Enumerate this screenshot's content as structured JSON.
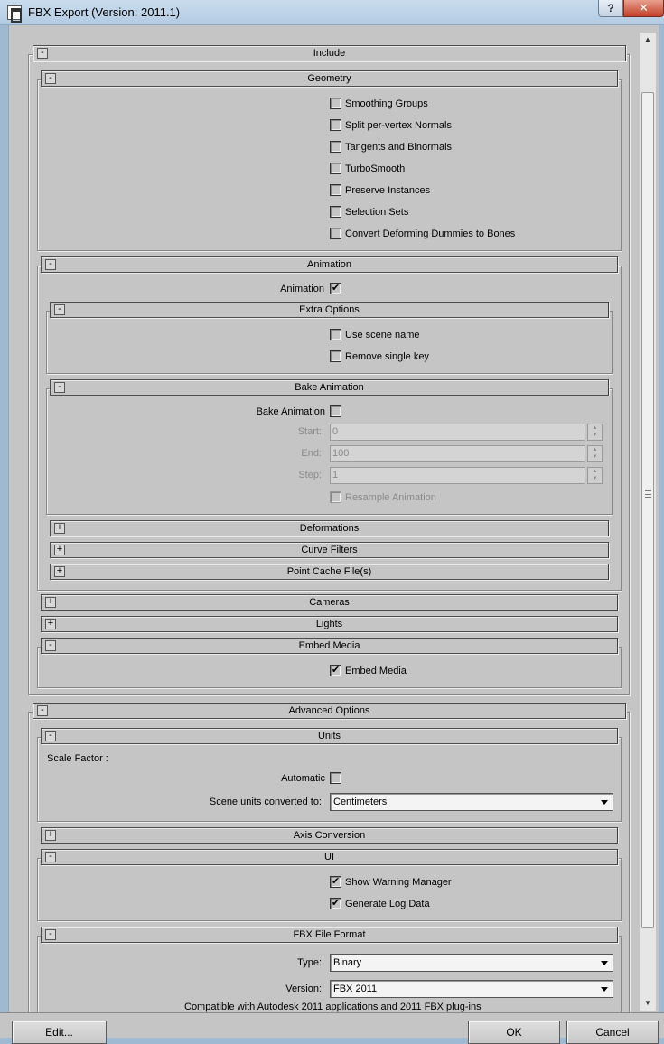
{
  "window": {
    "title": "FBX Export (Version: 2011.1)",
    "help_label": "?",
    "close_label": "✕"
  },
  "icons": {
    "expanded": "-",
    "collapsed": "+",
    "scroll_up": "▲",
    "scroll_down": "▼"
  },
  "include": {
    "label": "Include",
    "geometry": {
      "label": "Geometry",
      "options": [
        {
          "label": "Smoothing Groups",
          "checked": false
        },
        {
          "label": "Split per-vertex Normals",
          "checked": false
        },
        {
          "label": "Tangents and Binormals",
          "checked": false
        },
        {
          "label": "TurboSmooth",
          "checked": false
        },
        {
          "label": "Preserve Instances",
          "checked": false
        },
        {
          "label": "Selection Sets",
          "checked": false
        },
        {
          "label": "Convert Deforming Dummies to Bones",
          "checked": false
        }
      ]
    },
    "animation": {
      "label": "Animation",
      "animation_checkbox_label": "Animation",
      "animation_checked": true,
      "extra_options": {
        "label": "Extra Options",
        "use_scene_name": "Use scene name",
        "remove_single_key": "Remove single key"
      },
      "bake_animation": {
        "label": "Bake Animation",
        "checkbox_label": "Bake Animation",
        "start_label": "Start:",
        "start_value": "0",
        "end_label": "End:",
        "end_value": "100",
        "step_label": "Step:",
        "step_value": "1",
        "resample_label": "Resample Animation"
      },
      "deformations": "Deformations",
      "curve_filters": "Curve Filters",
      "point_cache": "Point Cache File(s)"
    },
    "cameras": "Cameras",
    "lights": "Lights",
    "embed_media": {
      "label": "Embed Media",
      "checkbox_label": "Embed Media",
      "checked": true
    }
  },
  "advanced": {
    "label": "Advanced Options",
    "units": {
      "label": "Units",
      "scale_factor": "Scale Factor :",
      "automatic_label": "Automatic",
      "scene_units_label": "Scene units converted to:",
      "scene_units_value": "Centimeters"
    },
    "axis_conversion": "Axis Conversion",
    "ui": {
      "label": "UI",
      "show_warning_manager": "Show Warning Manager",
      "generate_log_data": "Generate Log Data"
    },
    "fbx_format": {
      "label": "FBX File Format",
      "type_label": "Type:",
      "type_value": "Binary",
      "version_label": "Version:",
      "version_value": "FBX 2011",
      "compat_note": "Compatible with Autodesk 2011 applications and 2011 FBX plug-ins"
    }
  },
  "buttons": {
    "edit": "Edit...",
    "ok": "OK",
    "cancel": "Cancel"
  }
}
